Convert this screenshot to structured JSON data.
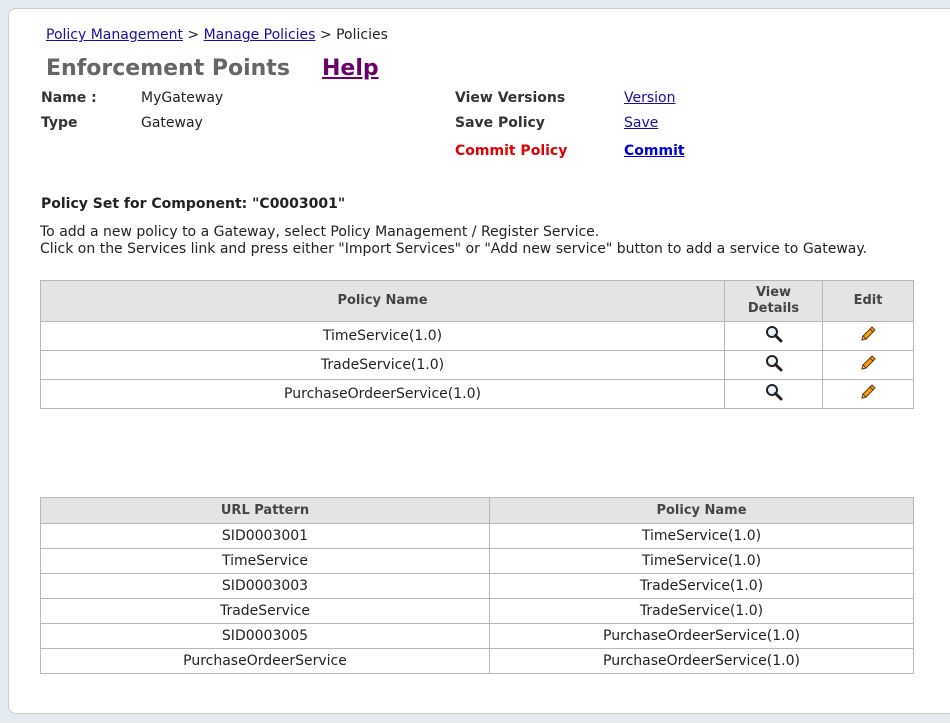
{
  "breadcrumb": {
    "items": [
      "Policy Management",
      "Manage Policies"
    ],
    "current": "Policies",
    "separator": ">"
  },
  "header": {
    "title": "Enforcement Points",
    "help_label": "Help"
  },
  "details": {
    "name_label": "Name :",
    "name_value": "MyGateway",
    "type_label": "Type",
    "type_value": "Gateway"
  },
  "actions": {
    "view_versions_label": "View Versions",
    "view_versions_link": "Version",
    "save_policy_label": "Save Policy",
    "save_policy_link": "Save",
    "commit_policy_label": "Commit Policy",
    "commit_policy_link": "Commit"
  },
  "policy_set": {
    "heading": "Policy Set for Component: \"C0003001\"",
    "info_line1": "To add a new policy to a Gateway, select Policy Management / Register Service.",
    "info_line2": "Click on the Services link and press either \"Import Services\" or \"Add new service\" button to add a service to Gateway."
  },
  "policies_table": {
    "headers": {
      "policy_name": "Policy Name",
      "view_details_1": "View",
      "view_details_2": "Details",
      "edit": "Edit"
    },
    "rows": [
      {
        "policy_name": "TimeService(1.0)",
        "view_icon": "magnifier-icon",
        "edit_icon": "pencil-icon"
      },
      {
        "policy_name": "TradeService(1.0)",
        "view_icon": "magnifier-icon",
        "edit_icon": "pencil-icon"
      },
      {
        "policy_name": "PurchaseOrdeerService(1.0)",
        "view_icon": "magnifier-icon",
        "edit_icon": "pencil-icon"
      }
    ]
  },
  "url_table": {
    "headers": {
      "url_pattern": "URL Pattern",
      "policy_name": "Policy Name"
    },
    "rows": [
      {
        "url_pattern": "SID0003001",
        "policy_name": "TimeService(1.0)"
      },
      {
        "url_pattern": "TimeService",
        "policy_name": "TimeService(1.0)"
      },
      {
        "url_pattern": "SID0003003",
        "policy_name": "TradeService(1.0)"
      },
      {
        "url_pattern": "TradeService",
        "policy_name": "TradeService(1.0)"
      },
      {
        "url_pattern": "SID0003005",
        "policy_name": "PurchaseOrdeerService(1.0)"
      },
      {
        "url_pattern": "PurchaseOrdeerService",
        "policy_name": "PurchaseOrdeerService(1.0)"
      }
    ]
  },
  "colors": {
    "link": "#1a0dab",
    "help": "#6a006a",
    "commit_label": "#e00000",
    "commit_link": "#0000dd",
    "header_bg": "#e4e4e4",
    "page_bg": "#e6ebf0"
  }
}
